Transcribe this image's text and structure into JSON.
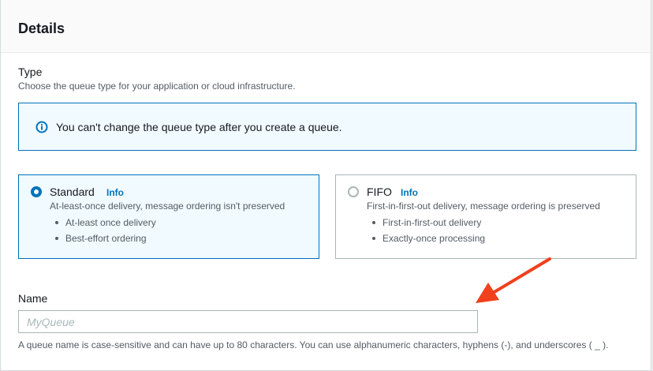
{
  "panel": {
    "title": "Details"
  },
  "type_field": {
    "label": "Type",
    "description": "Choose the queue type for your application or cloud infrastructure."
  },
  "alert": {
    "icon": "info-circle-icon",
    "text": "You can't change the queue type after you create a queue.",
    "color": "#0073bb"
  },
  "queue_types": [
    {
      "title": "Standard",
      "info": "Info",
      "selected": true,
      "description": "At-least-once delivery, message ordering isn't preserved",
      "bullets": [
        "At-least once delivery",
        "Best-effort ordering"
      ]
    },
    {
      "title": "FIFO",
      "info": "Info",
      "selected": false,
      "description": "First-in-first-out delivery, message ordering is preserved",
      "bullets": [
        "First-in-first-out delivery",
        "Exactly-once processing"
      ]
    }
  ],
  "name_field": {
    "label": "Name",
    "placeholder": "MyQueue",
    "value": "",
    "constraint": "A queue name is case-sensitive and can have up to 80 characters. You can use alphanumeric characters, hyphens (-), and underscores ( _ )."
  },
  "annotation": {
    "icon": "red-arrow-icon",
    "color": "#f0401c"
  }
}
